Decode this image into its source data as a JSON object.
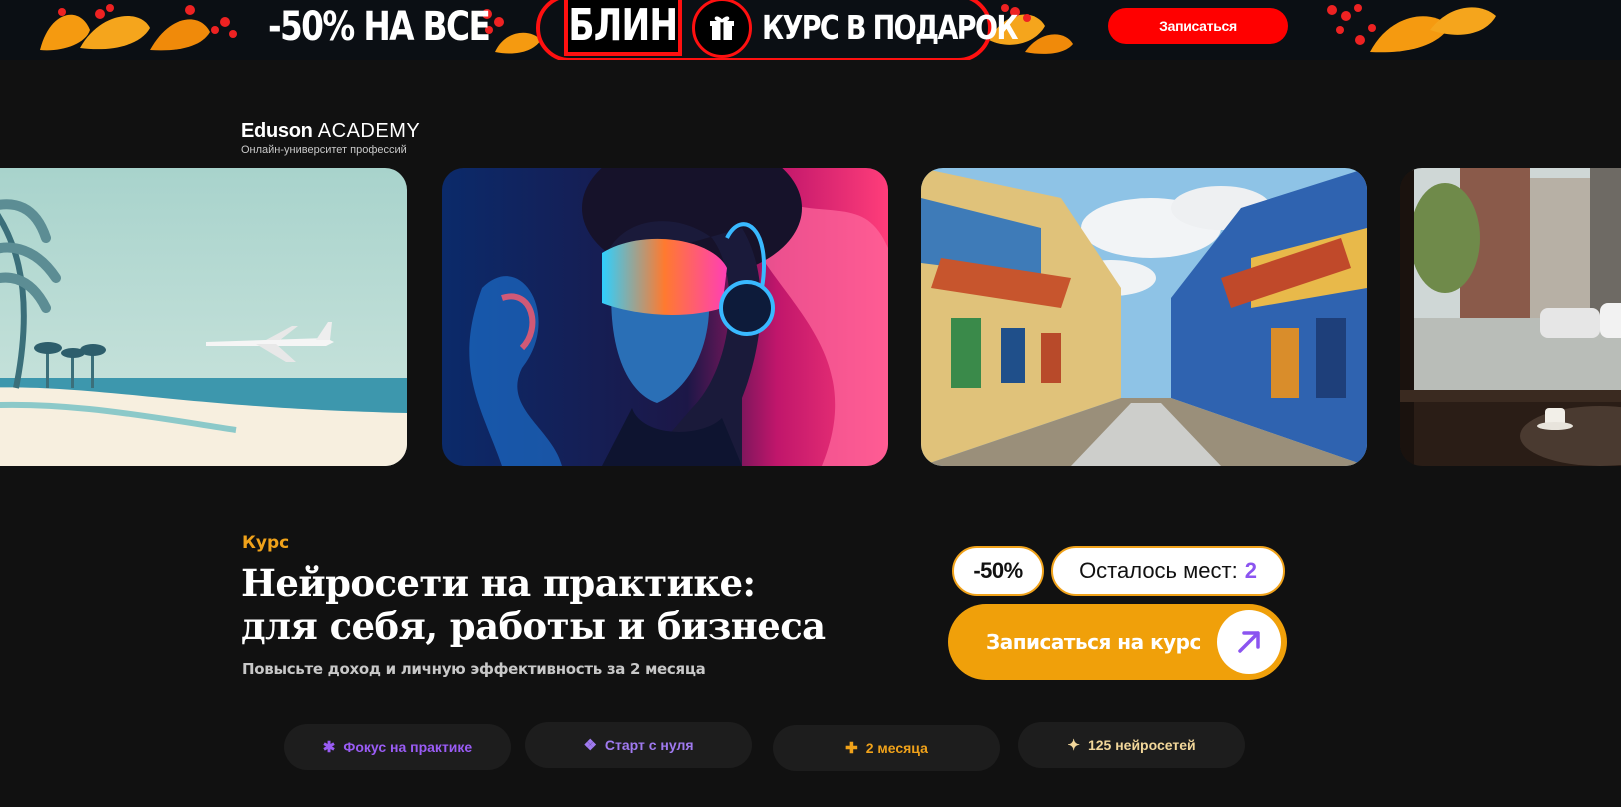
{
  "banner": {
    "promo_left": "-50% НА ВСЕ",
    "blin": "БЛИН",
    "promo_right": "КУРС В ПОДАРОК",
    "button": "Записаться",
    "accent": "#ff0000"
  },
  "logo": {
    "brand_bold": "Eduson",
    "brand_light": "ACADEMY",
    "tagline": "Онлайн-университет профессий"
  },
  "carousel": {
    "images": [
      "beach-airplane-image",
      "vr-woman-neon-image",
      "painted-street-image",
      "city-cafe-window-image"
    ]
  },
  "course": {
    "kicker": "Курс",
    "title_line1": "Нейросети на практике:",
    "title_line2": "для себя, работы и бизнеса",
    "subtitle": "Повысьте доход и личную эффективность за 2 месяца",
    "discount": "-50%",
    "seats_label": "Осталось мест:",
    "seats_count": "2",
    "cta": "Записаться на курс",
    "accent": "#f0a00a",
    "purple": "#8b54f0"
  },
  "chips": [
    {
      "icon": "✱",
      "label": "Фокус на практике"
    },
    {
      "icon": "❖",
      "label": "Старт с нуля"
    },
    {
      "icon": "✚",
      "label": "2 месяца"
    },
    {
      "icon": "✦",
      "label": "125 нейросетей"
    }
  ]
}
